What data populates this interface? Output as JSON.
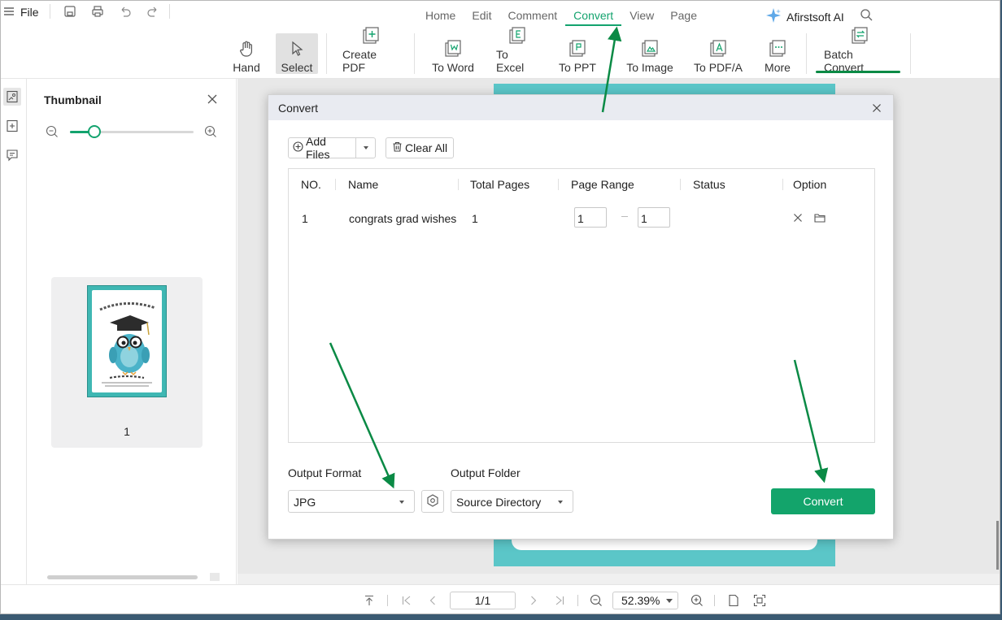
{
  "menu": {
    "file_label": "File",
    "tabs": [
      "Home",
      "Edit",
      "Comment",
      "Convert",
      "View",
      "Page"
    ],
    "active_tab": "Convert",
    "ai_label": "Afirstsoft AI"
  },
  "toolbar": {
    "hand": "Hand",
    "select": "Select",
    "create_pdf": "Create PDF",
    "to_word": "To Word",
    "to_excel": "To Excel",
    "to_ppt": "To PPT",
    "to_image": "To Image",
    "to_pdfa": "To PDF/A",
    "more": "More",
    "batch_convert": "Batch Convert"
  },
  "thumbnail": {
    "title": "Thumbnail",
    "zoom_fraction": 0.2,
    "page_number": "1"
  },
  "dialog": {
    "title": "Convert",
    "add_files": "Add Files",
    "clear_all": "Clear All",
    "columns": [
      "NO.",
      "Name",
      "Total Pages",
      "Page Range",
      "Status",
      "Option"
    ],
    "rows": [
      {
        "no": "1",
        "name": "congrats grad wishes",
        "total_pages": "1",
        "range_from": "1",
        "range_to": "1",
        "status": ""
      }
    ],
    "output_format_label": "Output Format",
    "output_format_value": "JPG",
    "output_folder_label": "Output Folder",
    "output_folder_value": "Source Directory",
    "convert_button": "Convert"
  },
  "statusbar": {
    "page": "1/1",
    "zoom": "52.39%"
  },
  "colors": {
    "accent": "#13a36e",
    "annotation_arrow": "#0a8a45"
  }
}
